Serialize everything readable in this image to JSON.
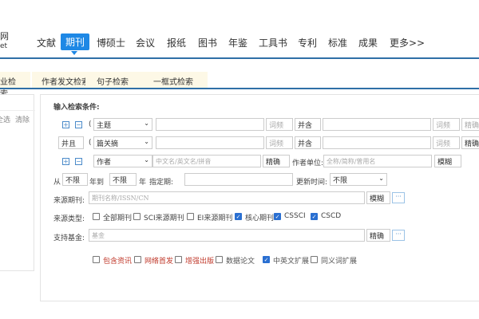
{
  "logo": {
    "line1": "网",
    "line2": "et"
  },
  "nav": {
    "items": [
      "文献",
      "期刊",
      "博硕士",
      "会议",
      "报纸",
      "图书",
      "年鉴",
      "工具书",
      "专利",
      "标准",
      "成果",
      "更多>>"
    ],
    "active": "期刊"
  },
  "tabs": [
    "业检索",
    "作者发文检索",
    "句子检索",
    "一框式检索"
  ],
  "sidebar": {
    "select_all": "全选",
    "clear": "清除"
  },
  "form": {
    "heading": "输入检索条件:",
    "row1": {
      "paren": "(",
      "field": "主题",
      "freq1": "词频",
      "op": "并含",
      "freq2": "词频",
      "match": "精确"
    },
    "row2": {
      "logic": "并且",
      "paren": "(",
      "field": "篇关摘",
      "freq1": "词频",
      "op": "并含",
      "freq2": "词频",
      "match": "精确"
    },
    "row3": {
      "field": "作者",
      "placeholder": "中文名/英文名/拼音",
      "match": "精确",
      "unit_label": "作者单位:",
      "unit_placeholder": "全称/简称/曾用名",
      "unit_match": "模糊"
    },
    "date": {
      "from": "从",
      "from_val": "不限",
      "year_to": "年到",
      "to_val": "不限",
      "year": "年",
      "period_label": "指定期:",
      "update_label": "更新时间:",
      "update_val": "不限"
    },
    "source": {
      "label": "来源期刊:",
      "placeholder": "期刊名称/ISSN/CN",
      "match": "模糊",
      "more": "···"
    },
    "type": {
      "label": "来源类型:",
      "options": [
        {
          "label": "全部期刊",
          "checked": false
        },
        {
          "label": "SCI来源期刊",
          "checked": false
        },
        {
          "label": "EI来源期刊",
          "checked": false
        },
        {
          "label": "核心期刊",
          "checked": true
        },
        {
          "label": "CSSCI",
          "checked": true
        },
        {
          "label": "CSCD",
          "checked": true
        }
      ]
    },
    "fund": {
      "label": "支持基金:",
      "placeholder": "基金",
      "match": "精确",
      "more": "···"
    },
    "extras": [
      {
        "label": "包含资讯",
        "checked": false,
        "color": "#c0392b"
      },
      {
        "label": "网络首发",
        "checked": false,
        "color": "#c0392b"
      },
      {
        "label": "增强出版",
        "checked": false,
        "color": "#c0392b"
      },
      {
        "label": "数据论文",
        "checked": false,
        "color": "#555"
      },
      {
        "label": "中英文扩展",
        "checked": true,
        "color": "#555"
      },
      {
        "label": "同义词扩展",
        "checked": false,
        "color": "#555"
      }
    ]
  }
}
